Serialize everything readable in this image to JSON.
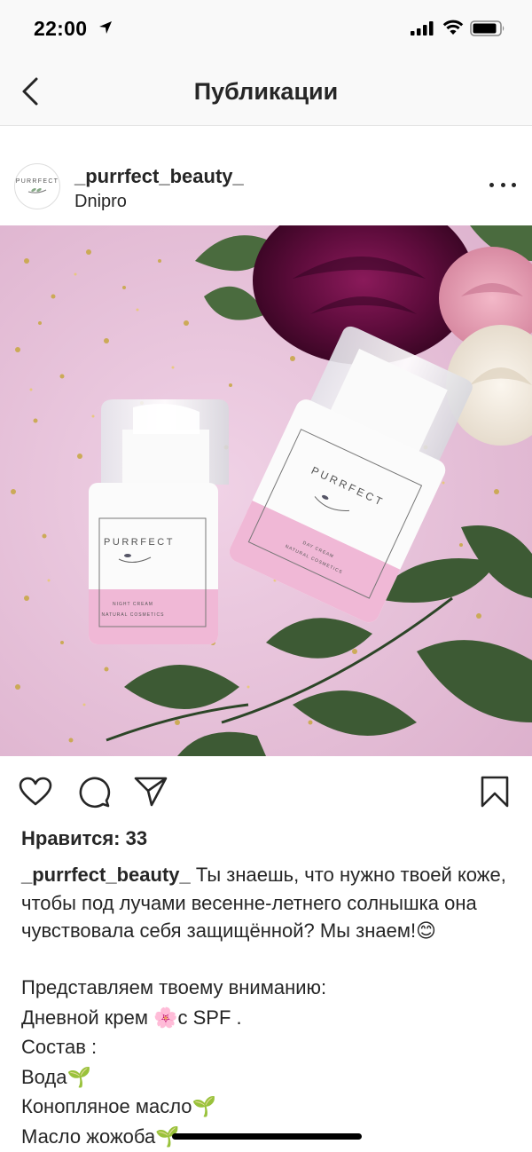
{
  "status_bar": {
    "time": "22:00"
  },
  "nav": {
    "title": "Публикации"
  },
  "post": {
    "username": "_purrfect_beauty_",
    "location": "Dnipro",
    "avatar_brand": "PURRFECT",
    "image": {
      "jar_left_brand": "PURRFECT",
      "jar_left_line1": "NIGHT CREAM",
      "jar_left_line2": "NATURAL COSMETICS",
      "jar_right_brand": "PURRFECT",
      "jar_right_line1": "DAY CREAM",
      "jar_right_line2": "NATURAL COSMETICS"
    },
    "likes": "Нравится: 33",
    "caption_user": "_purrfect_beauty_",
    "caption_text": " Ты знаешь, что нужно твоей коже, чтобы под лучами весенне-летнего солнышка она чувствовала себя защищённой? Мы знаем!😊",
    "lines": [
      "Представляем твоему вниманию:",
      "Дневной крем 🌸с SPF .",
      "Состав :",
      "Вода🌱",
      "Конопляное масло🌱",
      "Масло жожоба🌱"
    ]
  },
  "icons": {
    "back": "chevron-left-icon",
    "more": "more-icon",
    "like": "heart-icon",
    "comment": "comment-icon",
    "share": "send-icon",
    "save": "bookmark-icon"
  }
}
